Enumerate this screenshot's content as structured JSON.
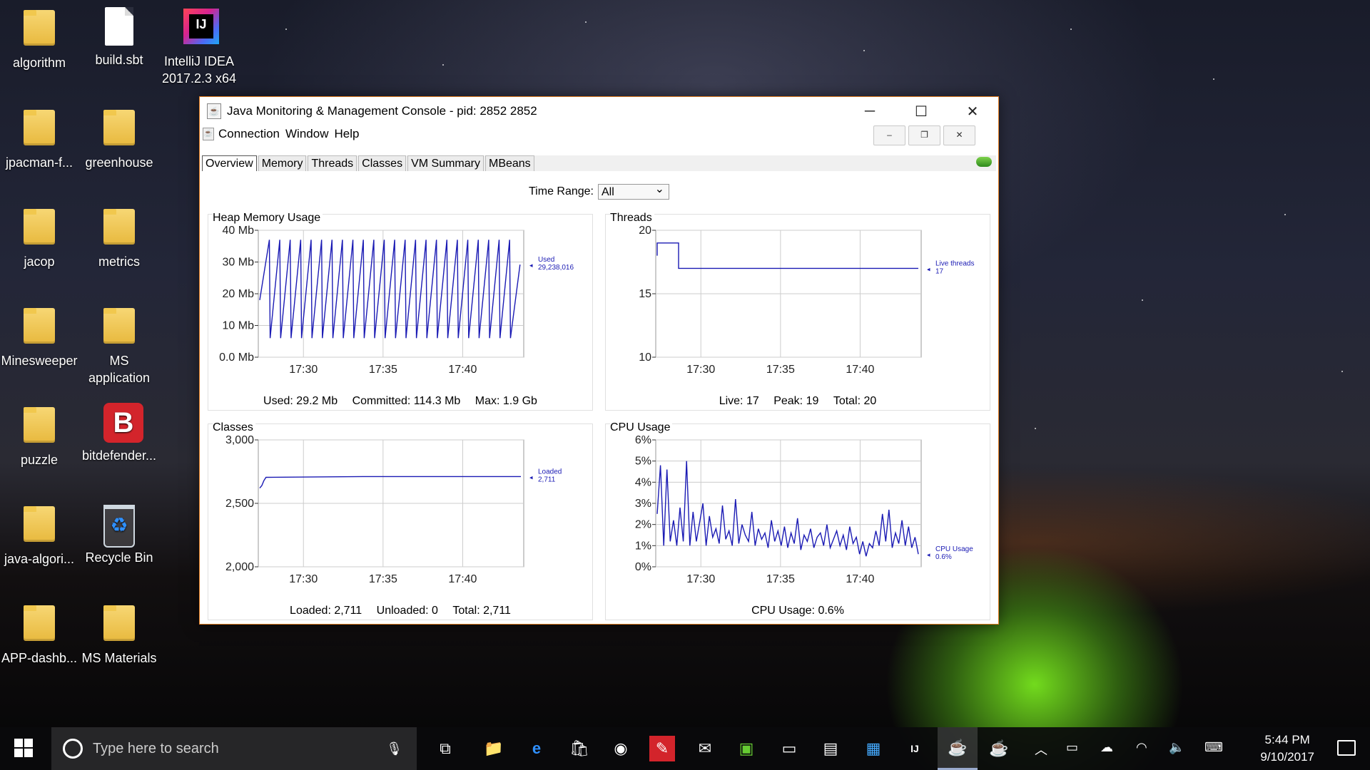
{
  "desktop": {
    "icons": [
      {
        "label": "algorithm",
        "icon": "folder-icon"
      },
      {
        "label": "build.sbt",
        "icon": "file-icon"
      },
      {
        "label": "IntelliJ IDEA 2017.2.3 x64",
        "icon": "intellij-icon"
      },
      {
        "label": "jpacman-f...",
        "icon": "folder-icon"
      },
      {
        "label": "greenhouse",
        "icon": "folder-icon"
      },
      {
        "label": "jacop",
        "icon": "folder-icon"
      },
      {
        "label": "metrics",
        "icon": "folder-icon"
      },
      {
        "label": "Minesweeper",
        "icon": "folder-icon"
      },
      {
        "label": "MS application",
        "icon": "folder-icon"
      },
      {
        "label": "puzzle",
        "icon": "folder-icon"
      },
      {
        "label": "bitdefender...",
        "icon": "bitdefender-icon"
      },
      {
        "label": "java-algori...",
        "icon": "folder-icon"
      },
      {
        "label": "Recycle Bin",
        "icon": "recycle-bin-icon"
      },
      {
        "label": "APP-dashb...",
        "icon": "folder-icon"
      },
      {
        "label": "MS Materials",
        "icon": "folder-icon"
      }
    ]
  },
  "window": {
    "title": "Java Monitoring & Management Console - pid: 2852 2852",
    "menu": [
      "Connection",
      "Window",
      "Help"
    ],
    "tabs": [
      "Overview",
      "Memory",
      "Threads",
      "Classes",
      "VM Summary",
      "MBeans"
    ],
    "time_range_label": "Time Range:",
    "time_range_value": "All"
  },
  "panels": {
    "heap": {
      "title": "Heap Memory Usage",
      "legend_name": "Used",
      "legend_value": "29,238,016",
      "footer": [
        "Used: 29.2 Mb",
        "Committed: 114.3 Mb",
        "Max: 1.9 Gb"
      ]
    },
    "threads": {
      "title": "Threads",
      "legend_name": "Live threads",
      "legend_value": "17",
      "footer": [
        "Live: 17",
        "Peak: 19",
        "Total: 20"
      ]
    },
    "classes": {
      "title": "Classes",
      "legend_name": "Loaded",
      "legend_value": "2,711",
      "footer": [
        "Loaded: 2,711",
        "Unloaded: 0",
        "Total: 2,711"
      ]
    },
    "cpu": {
      "title": "CPU Usage",
      "legend_name": "CPU Usage",
      "legend_value": "0.6%",
      "footer": [
        "CPU Usage: 0.6%"
      ]
    }
  },
  "chart_data": [
    {
      "type": "line",
      "title": "Heap Memory Usage",
      "x_ticks": [
        "17:30",
        "17:35",
        "17:40"
      ],
      "y_ticks": [
        "40 Mb",
        "30 Mb",
        "20 Mb",
        "10 Mb",
        "0.0 Mb"
      ],
      "ylim": [
        0,
        40
      ],
      "series": [
        {
          "name": "Used",
          "sawtooth_low_mb": 6,
          "sawtooth_high_mb": 37,
          "cycles": 24,
          "last_mb": 29.2
        }
      ]
    },
    {
      "type": "line",
      "title": "Threads",
      "x_ticks": [
        "17:30",
        "17:35",
        "17:40"
      ],
      "y_ticks": [
        "20",
        "15",
        "10"
      ],
      "ylim": [
        10,
        20
      ],
      "series": [
        {
          "name": "Live threads",
          "values": [
            18,
            19,
            19,
            17,
            17,
            17,
            17,
            17,
            17,
            17,
            17
          ]
        }
      ]
    },
    {
      "type": "line",
      "title": "Classes",
      "x_ticks": [
        "17:30",
        "17:35",
        "17:40"
      ],
      "y_ticks": [
        "3,000",
        "2,500",
        "2,000"
      ],
      "ylim": [
        2000,
        3000
      ],
      "series": [
        {
          "name": "Loaded",
          "values": [
            2620,
            2640,
            2680,
            2705,
            2711,
            2711,
            2711,
            2711,
            2711,
            2711,
            2711
          ]
        }
      ]
    },
    {
      "type": "line",
      "title": "CPU Usage",
      "x_ticks": [
        "17:30",
        "17:35",
        "17:40"
      ],
      "y_ticks": [
        "6%",
        "5%",
        "4%",
        "3%",
        "2%",
        "1%",
        "0%"
      ],
      "ylim": [
        0,
        6
      ],
      "series": [
        {
          "name": "CPU Usage",
          "values": [
            2.5,
            4.8,
            1.0,
            4.6,
            1.2,
            2.2,
            1.0,
            2.8,
            1.2,
            5.0,
            1.0,
            2.6,
            1.2,
            2.1,
            3.0,
            1.0,
            2.4,
            1.4,
            1.8,
            1.1,
            2.9,
            1.3,
            1.7,
            1.0,
            3.2,
            1.1,
            2.0,
            1.5,
            1.2,
            2.6,
            1.0,
            1.8,
            1.3,
            1.6,
            0.9,
            2.2,
            1.2,
            1.7,
            1.0,
            1.9,
            0.9,
            1.6,
            1.1,
            2.3,
            0.8,
            1.5,
            1.2,
            1.8,
            0.9,
            1.4,
            1.6,
            1.0,
            2.0,
            0.9,
            1.3,
            1.7,
            1.0,
            1.5,
            0.8,
            1.9,
            1.1,
            1.4,
            0.6,
            1.2,
            0.5,
            1.1,
            0.9,
            1.7,
            1.0,
            2.5,
            1.2,
            2.7,
            0.9,
            1.6,
            1.1,
            2.2,
            1.0,
            1.9,
            0.9,
            1.4,
            0.6
          ]
        }
      ]
    }
  ],
  "taskbar": {
    "search_placeholder": "Type here to search",
    "time": "5:44 PM",
    "date": "9/10/2017"
  }
}
